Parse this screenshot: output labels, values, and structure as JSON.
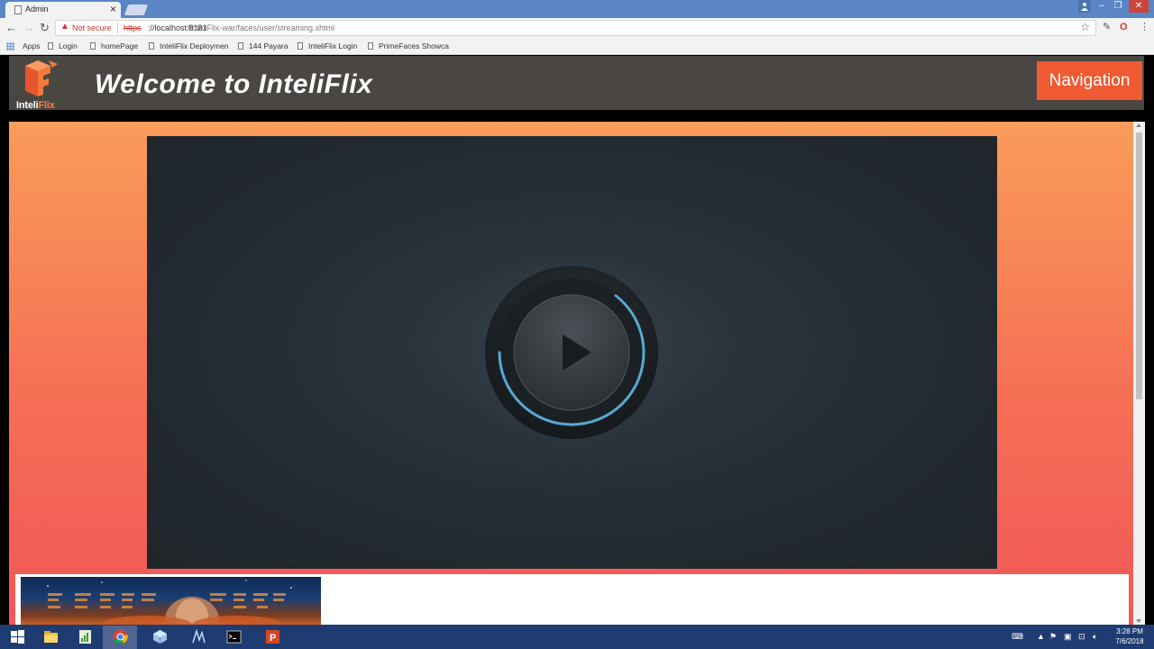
{
  "browser": {
    "tab_title": "Admin",
    "tab_close": "×",
    "security_label": "Not secure",
    "url_scheme": "https",
    "url_host": "://localhost:8181",
    "url_path": "/InteliFlix-war/faces/user/streaming.xhtml",
    "bookmarks": [
      {
        "label": "Apps",
        "icon": "apps-grid-icon"
      },
      {
        "label": "Login",
        "icon": "page-icon"
      },
      {
        "label": "homePage",
        "icon": "page-icon"
      },
      {
        "label": "InteliFlix Deploymen",
        "icon": "page-icon"
      },
      {
        "label": "144 Payara",
        "icon": "page-icon"
      },
      {
        "label": "InteliFlix Login",
        "icon": "page-icon"
      },
      {
        "label": "PrimeFaces Showca",
        "icon": "page-icon"
      }
    ]
  },
  "header": {
    "logo_text_a": "Inteli",
    "logo_text_b": "Flix",
    "welcome": "Welcome to InteliFlix",
    "nav_button": "Navigation"
  },
  "colors": {
    "header_bg": "#4a4743",
    "nav_button_bg": "#ef5a32",
    "content_gradient_top": "#fa9c5a",
    "content_gradient_bottom": "#f05757",
    "video_bg": "#22292f",
    "progress_ring": "#5fb7e6"
  },
  "video": {
    "state": "loading",
    "play_icon": "play-icon"
  },
  "taskbar": {
    "time": "3:28 PM",
    "date": "7/6/2018",
    "apps": [
      "windows-start-icon",
      "file-explorer-icon",
      "notepad-icon",
      "chrome-icon",
      "virtualbox-icon",
      "netbeans-icon",
      "terminal-icon",
      "powerpoint-icon"
    ]
  }
}
